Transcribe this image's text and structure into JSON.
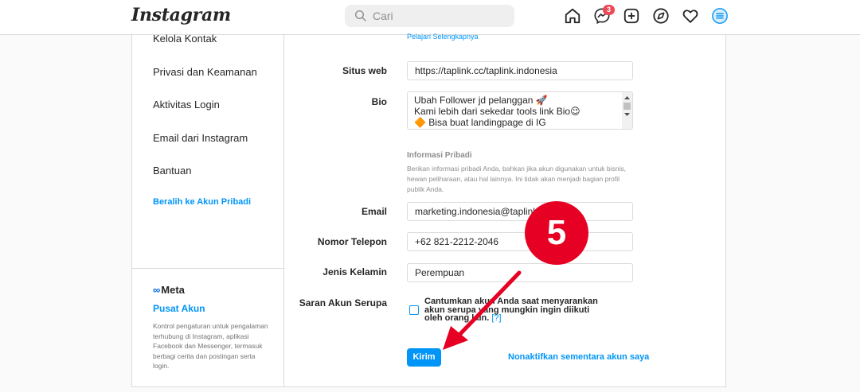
{
  "header": {
    "logo": "Instagram",
    "search_placeholder": "Cari",
    "messenger_badge": "3",
    "nav_icons": [
      "home-icon",
      "messenger-icon",
      "new-post-icon",
      "explore-icon",
      "activity-heart-icon",
      "profile-menu-icon"
    ]
  },
  "sidebar": {
    "items": [
      "Kelola Kontak",
      "Privasi dan Keamanan",
      "Aktivitas Login",
      "Email dari Instagram",
      "Bantuan"
    ],
    "switch_link": "Beralih ke Akun Pribadi",
    "meta": {
      "logo": "Meta",
      "title": "Pusat Akun",
      "description": "Kontrol pengaturan untuk pengalaman terhubung di Instagram, aplikasi Facebook dan Messenger, termasuk berbagi cerita dan postingan serta login."
    }
  },
  "form": {
    "learn_more": "Pelajari Selengkapnya",
    "website_label": "Situs web",
    "website_value": "https://taplink.cc/taplink.indonesia",
    "bio_label": "Bio",
    "bio_lines": [
      "Ubah Follower jd pelanggan 🚀",
      "Kami lebih dari sekedar tools link Bio😉",
      "🔶 Bisa buat landingpage di IG"
    ],
    "personal_info_title": "Informasi Pribadi",
    "personal_info_desc": "Berikan informasi pribadi Anda, bahkan jika akun digunakan untuk bisnis, hewan peliharaan, atau hal lainnya. Ini tidak akan menjadi bagian profil publik Anda.",
    "email_label": "Email",
    "email_value": "marketing.indonesia@taplink.cc",
    "phone_label": "Nomor Telepon",
    "phone_value": "+62 821-2212-2046",
    "gender_label": "Jenis Kelamin",
    "gender_value": "Perempuan",
    "suggest_label": "Saran Akun Serupa",
    "suggest_text": "Cantumkan akun Anda saat menyarankan akun serupa yang mungkin ingin diikuti oleh orang lain.",
    "suggest_help": "[?]",
    "submit_label": "Kirim",
    "deactivate_label": "Nonaktifkan sementara akun saya"
  },
  "annotation": {
    "step_number": "5",
    "color": "#e60023"
  }
}
